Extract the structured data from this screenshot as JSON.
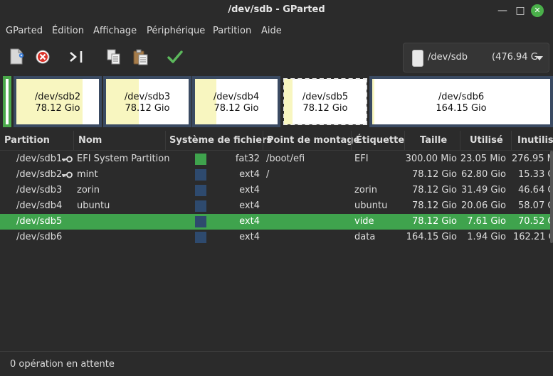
{
  "window": {
    "title": "/dev/sdb - GParted"
  },
  "menu": [
    "GParted",
    "Édition",
    "Affichage",
    "Périphérique",
    "Partition",
    "Aide"
  ],
  "device": {
    "name": "/dev/sdb",
    "size": "(476.94 G"
  },
  "visual": [
    {
      "name": "/dev/sdb2",
      "size": "78.12 Gio",
      "used_fraction": 0.8
    },
    {
      "name": "/dev/sdb3",
      "size": "78.12 Gio",
      "used_fraction": 0.4
    },
    {
      "name": "/dev/sdb4",
      "size": "78.12 Gio",
      "used_fraction": 0.26
    },
    {
      "name": "/dev/sdb5",
      "size": "78.12 Gio",
      "used_fraction": 0.1
    },
    {
      "name": "/dev/sdb6",
      "size": "164.15 Gio",
      "used_fraction": 0.01
    }
  ],
  "table": {
    "headers": [
      "Partition",
      "Nom",
      "Système de fichiers",
      "Point de montage",
      "Étiquette",
      "Taille",
      "Utilisé",
      "Inutilisé"
    ],
    "rows": [
      {
        "partition": "/dev/sdb1",
        "key": true,
        "nom": "EFI System Partition",
        "fs": "fat32",
        "fs_color": "#3fa34d",
        "mount": "/boot/efi",
        "label": "EFI",
        "size": "300.00 Mio",
        "used": "23.05 Mio",
        "unused": "276.95 M"
      },
      {
        "partition": "/dev/sdb2",
        "key": true,
        "nom": "mint",
        "fs": "ext4",
        "fs_color": "#2e4a6e",
        "mount": "/",
        "label": "",
        "size": "78.12 Gio",
        "used": "62.80 Gio",
        "unused": "15.33 G"
      },
      {
        "partition": "/dev/sdb3",
        "key": false,
        "nom": "zorin",
        "fs": "ext4",
        "fs_color": "#2e4a6e",
        "mount": "",
        "label": "zorin",
        "size": "78.12 Gio",
        "used": "31.49 Gio",
        "unused": "46.64 G"
      },
      {
        "partition": "/dev/sdb4",
        "key": false,
        "nom": "ubuntu",
        "fs": "ext4",
        "fs_color": "#2e4a6e",
        "mount": "",
        "label": "ubuntu",
        "size": "78.12 Gio",
        "used": "20.06 Gio",
        "unused": "58.07 G"
      },
      {
        "partition": "/dev/sdb5",
        "key": false,
        "nom": "",
        "fs": "ext4",
        "fs_color": "#2e4a6e",
        "mount": "",
        "label": "vide",
        "size": "78.12 Gio",
        "used": "7.61 Gio",
        "unused": "70.52 G"
      },
      {
        "partition": "/dev/sdb6",
        "key": false,
        "nom": "",
        "fs": "ext4",
        "fs_color": "#2e4a6e",
        "mount": "",
        "label": "data",
        "size": "164.15 Gio",
        "used": "1.94 Gio",
        "unused": "162.21 G"
      }
    ],
    "selected_index": 4
  },
  "status": "0 opération en attente",
  "colors": {
    "selection": "#3fa34d",
    "partition_border": "#3a4a62",
    "used_fill": "#f8f6c0",
    "apply": "#5cb85c"
  },
  "icons": [
    "new-icon",
    "delete-icon",
    "resize-move-icon",
    "copy-icon",
    "paste-icon",
    "apply-icon",
    "disk-icon",
    "key-icon"
  ]
}
